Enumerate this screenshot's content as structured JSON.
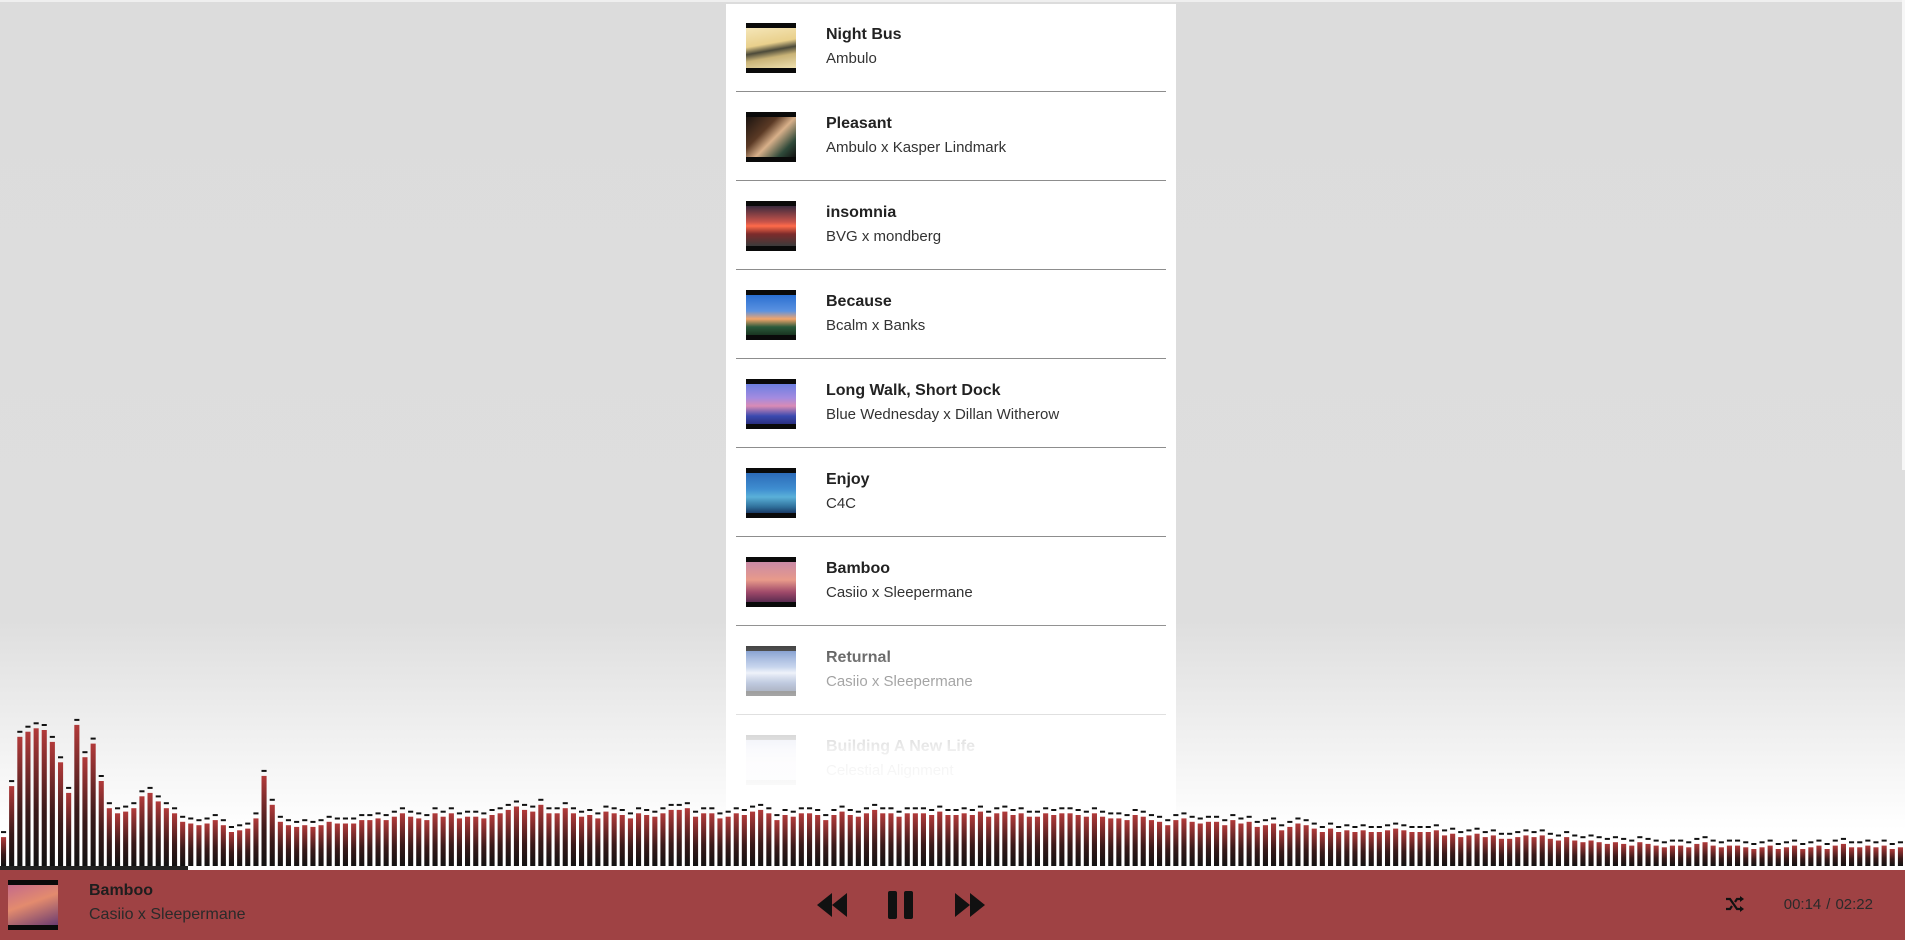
{
  "playlist": {
    "tracks": [
      {
        "title": "Night Bus",
        "artist": "Ambulo",
        "art": "linear-gradient(170deg,#f5e6b8 0%,#e9d08c 40%,#4c4a3a 55%,#c9b377 70%,#efe1b0 100%)"
      },
      {
        "title": "Pleasant",
        "artist": "Ambulo x Kasper Lindmark",
        "art": "linear-gradient(135deg,#1b1410 0%,#5b3a25 35%,#d8b08a 55%,#2f4a3a 80%,#111 100%)"
      },
      {
        "title": "insomnia",
        "artist": "BVG x mondberg",
        "art": "linear-gradient(to bottom,#3b2a3d 0%,#c9544a 40%,#ff6b4a 50%,#7d2b2b 70%,#3b3b3b 100%)"
      },
      {
        "title": "Because",
        "artist": "Bcalm x Banks",
        "art": "linear-gradient(to bottom,#2a6fd1 0%,#5b92e0 40%,#f2a56b 60%,#2b5a3b 80%,#193520 100%)"
      },
      {
        "title": "Long Walk, Short Dock",
        "artist": "Blue Wednesday x Dillan Witherow",
        "art": "linear-gradient(to bottom,#6d7fe0 0%,#a48be0 35%,#d98bb5 55%,#3b4ab0 80%,#2a2f80 100%)"
      },
      {
        "title": "Enjoy",
        "artist": "C4C",
        "art": "linear-gradient(to bottom,#2c6bb8 0%,#3f8ed0 40%,#5ab0d8 60%,#2f6f9a 85%,#1a3b66 100%)"
      },
      {
        "title": "Bamboo",
        "artist": "Casiio x Sleepermane",
        "art": "linear-gradient(to bottom,#c98aa6 0%,#e89a8a 45%,#a04a6a 75%,#5a2b50 100%)"
      },
      {
        "title": "Returnal",
        "artist": "Casiio x Sleepermane",
        "art": "linear-gradient(to bottom,#5a7fc0 0%,#9fb6e0 40%,#dfe6f5 55%,#6e86b8 80%,#34466e 100%)"
      },
      {
        "title": "Building A New Life",
        "artist": "Celestial Alignment",
        "art": "linear-gradient(to bottom,#a9b3d8 0%,#c7c9e6 40%,#e4d6e6 60%,#b8bcd8 100%)"
      }
    ]
  },
  "player": {
    "now_playing": {
      "title": "Bamboo",
      "artist": "Casiio x Sleepermane"
    },
    "current_time": "00:14",
    "separator": "/",
    "duration": "02:22",
    "progress_fraction": 0.0986,
    "accent_color": "#9f4244",
    "icons": {
      "prev": "rewind-icon",
      "pause": "pause-icon",
      "next": "fast-forward-icon",
      "shuffle": "shuffle-icon"
    }
  },
  "visualizer": {
    "levels": [
      0.17,
      0.47,
      0.76,
      0.79,
      0.81,
      0.8,
      0.73,
      0.61,
      0.43,
      0.83,
      0.64,
      0.72,
      0.5,
      0.34,
      0.31,
      0.32,
      0.34,
      0.41,
      0.43,
      0.38,
      0.34,
      0.31,
      0.26,
      0.25,
      0.24,
      0.25,
      0.27,
      0.24,
      0.2,
      0.21,
      0.22,
      0.28,
      0.53,
      0.36,
      0.26,
      0.24,
      0.23,
      0.24,
      0.23,
      0.24,
      0.26,
      0.25,
      0.25,
      0.25,
      0.27,
      0.27,
      0.28,
      0.27,
      0.29,
      0.31,
      0.29,
      0.28,
      0.27,
      0.31,
      0.29,
      0.31,
      0.28,
      0.29,
      0.29,
      0.28,
      0.3,
      0.31,
      0.33,
      0.35,
      0.33,
      0.32,
      0.36,
      0.31,
      0.31,
      0.34,
      0.31,
      0.29,
      0.3,
      0.28,
      0.32,
      0.31,
      0.3,
      0.28,
      0.31,
      0.3,
      0.29,
      0.31,
      0.33,
      0.33,
      0.34,
      0.29,
      0.31,
      0.31,
      0.28,
      0.29,
      0.31,
      0.3,
      0.32,
      0.33,
      0.31,
      0.27,
      0.3,
      0.29,
      0.31,
      0.31,
      0.3,
      0.27,
      0.3,
      0.32,
      0.3,
      0.29,
      0.31,
      0.33,
      0.31,
      0.31,
      0.29,
      0.31,
      0.31,
      0.31,
      0.3,
      0.32,
      0.3,
      0.3,
      0.31,
      0.3,
      0.32,
      0.29,
      0.31,
      0.32,
      0.3,
      0.31,
      0.29,
      0.29,
      0.31,
      0.3,
      0.31,
      0.31,
      0.3,
      0.29,
      0.31,
      0.29,
      0.28,
      0.28,
      0.27,
      0.3,
      0.29,
      0.27,
      0.26,
      0.24,
      0.27,
      0.28,
      0.26,
      0.25,
      0.26,
      0.26,
      0.24,
      0.27,
      0.25,
      0.26,
      0.23,
      0.24,
      0.25,
      0.21,
      0.23,
      0.25,
      0.24,
      0.22,
      0.2,
      0.22,
      0.2,
      0.21,
      0.2,
      0.21,
      0.2,
      0.2,
      0.21,
      0.22,
      0.21,
      0.2,
      0.2,
      0.2,
      0.21,
      0.18,
      0.19,
      0.17,
      0.18,
      0.19,
      0.17,
      0.18,
      0.16,
      0.16,
      0.17,
      0.18,
      0.17,
      0.18,
      0.16,
      0.15,
      0.17,
      0.15,
      0.14,
      0.15,
      0.14,
      0.13,
      0.14,
      0.13,
      0.12,
      0.14,
      0.13,
      0.12,
      0.11,
      0.12,
      0.12,
      0.11,
      0.13,
      0.14,
      0.12,
      0.11,
      0.12,
      0.12,
      0.11,
      0.1,
      0.11,
      0.12,
      0.1,
      0.11,
      0.12,
      0.1,
      0.11,
      0.12,
      0.1,
      0.12,
      0.13,
      0.11,
      0.11,
      0.12,
      0.11,
      0.12,
      0.1,
      0.11
    ]
  }
}
